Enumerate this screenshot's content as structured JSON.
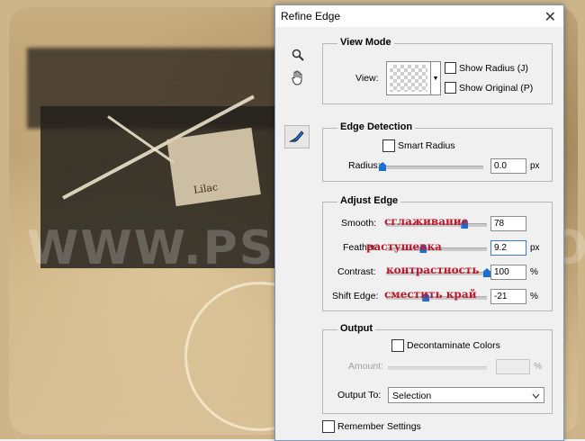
{
  "background": {
    "basket_tag": "Lilac",
    "watermark": "WWW.PSD-DUDE.COM"
  },
  "dialog": {
    "title": "Refine Edge",
    "close_glyph": "✕"
  },
  "tools": {
    "zoom_icon": "zoom-icon",
    "hand_icon": "hand-icon",
    "refine_icon": "refine-radius-brush-icon"
  },
  "view_mode": {
    "title": "View Mode",
    "view_label": "View:",
    "show_radius": "Show Radius (J)",
    "show_original": "Show Original (P)"
  },
  "edge_detection": {
    "title": "Edge Detection",
    "smart_radius": "Smart Radius",
    "radius_label": "Radius:",
    "radius_value": "0.0",
    "radius_unit": "px",
    "radius_fraction": 0.0
  },
  "adjust_edge": {
    "title": "Adjust Edge",
    "smooth_label": "Smooth:",
    "smooth_value": "78",
    "smooth_ru": "сглаживание",
    "smooth_fraction": 0.78,
    "feather_label": "Feather:",
    "feather_value": "9.2",
    "feather_unit": "px",
    "feather_ru": "растушевка",
    "feather_fraction": 0.37,
    "contrast_label": "Contrast:",
    "contrast_value": "100",
    "contrast_unit": "%",
    "contrast_ru": "контрастность",
    "contrast_fraction": 1.0,
    "shift_label": "Shift Edge:",
    "shift_value": "-21",
    "shift_unit": "%",
    "shift_ru": "сместить край",
    "shift_fraction": 0.395
  },
  "output": {
    "title": "Output",
    "decontaminate": "Decontaminate Colors",
    "amount_label": "Amount:",
    "amount_unit": "%",
    "output_to_label": "Output To:",
    "output_to_value": "Selection"
  },
  "remember": "Remember Settings",
  "colors": {
    "slider_thumb": "#1a6fd1",
    "russian_annotation": "#c0182a"
  }
}
